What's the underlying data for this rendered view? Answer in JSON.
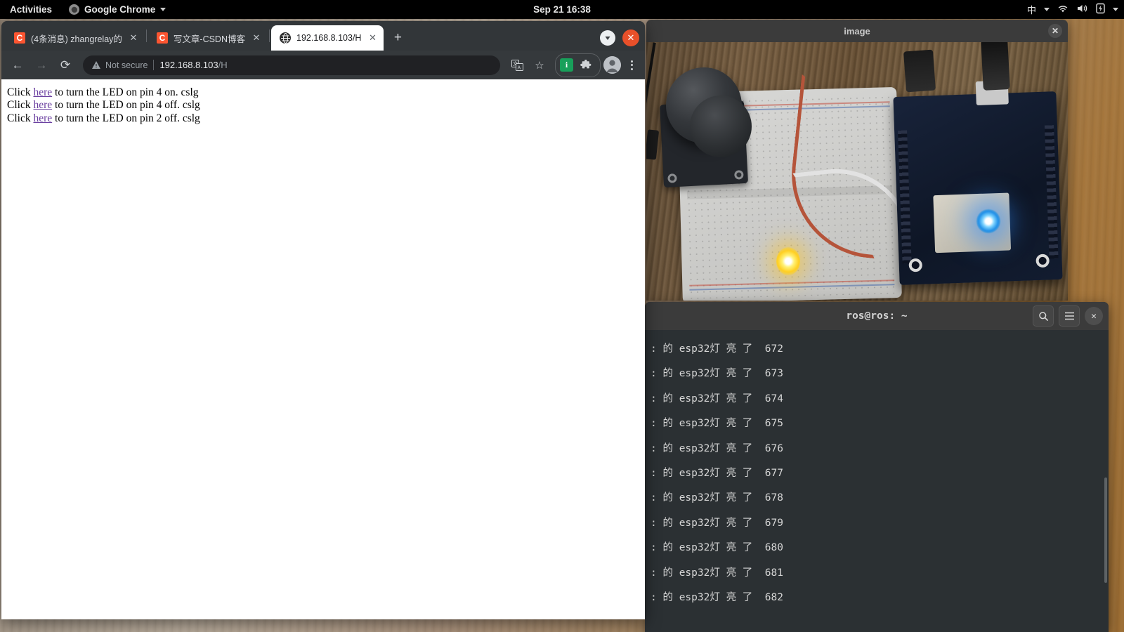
{
  "topbar": {
    "activities": "Activities",
    "app_menu": "Google Chrome",
    "clock": "Sep 21 16:38",
    "ime": "中",
    "icons": [
      "wifi-icon",
      "volume-icon",
      "battery-icon",
      "system-menu-chevron-icon"
    ]
  },
  "browser": {
    "tabs": [
      {
        "title": "(4条消息) zhangrelay的",
        "favicon": "csdn-favicon",
        "favicon_letter": "C",
        "active": false
      },
      {
        "title": "写文章-CSDN博客",
        "favicon": "csdn-favicon",
        "favicon_letter": "C",
        "active": false
      },
      {
        "title": "192.168.8.103/H",
        "favicon": "globe-favicon",
        "favicon_letter": "",
        "active": true
      }
    ],
    "new_tab_label": "+",
    "tab_close_label": "✕",
    "window_close_label": "✕",
    "toolbar": {
      "back_label": "←",
      "forward_label": "→",
      "reload_label": "⟳",
      "security_label": "Not secure",
      "url_host": "192.168.8.103",
      "url_path": "/H",
      "translate_icon": "translate-icon",
      "bookmark_label": "☆",
      "extension_badge_letter": "i",
      "extensions_label": "🧩",
      "menu_label": "⋮"
    },
    "page": {
      "lines": [
        {
          "prefix": "Click ",
          "link": "here",
          "suffix": " to turn the LED on pin 4 on. cslg"
        },
        {
          "prefix": "Click ",
          "link": "here",
          "suffix": " to turn the LED on pin 4 off. cslg"
        },
        {
          "prefix": "Click ",
          "link": "here",
          "suffix": " to turn the LED on pin 2 off. cslg"
        }
      ]
    }
  },
  "image_window": {
    "title": "image",
    "close_label": "✕",
    "photo_description": "ESP32 dev board on breadboard with lit yellow LED, joystick module and wiring on a wooden desk"
  },
  "terminal": {
    "title": "ros@ros: ~",
    "search_label": "🔍",
    "menu_label": "☰",
    "close_label": "✕",
    "lines": [
      ": 的 esp32灯 亮 了  672",
      ": 的 esp32灯 亮 了  673",
      ": 的 esp32灯 亮 了  674",
      ": 的 esp32灯 亮 了  675",
      ": 的 esp32灯 亮 了  676",
      ": 的 esp32灯 亮 了  677",
      ": 的 esp32灯 亮 了  678",
      ": 的 esp32灯 亮 了  679",
      ": 的 esp32灯 亮 了  680",
      ": 的 esp32灯 亮 了  681",
      ": 的 esp32灯 亮 了  682"
    ]
  },
  "colors": {
    "csdn_red": "#fc5531",
    "chrome_close_orange": "#e8502a",
    "extension_green": "#18a05a",
    "link_purple": "#6a3fa0",
    "terminal_bg": "#2b3033",
    "titlebar_gray": "#3b3b3b"
  }
}
